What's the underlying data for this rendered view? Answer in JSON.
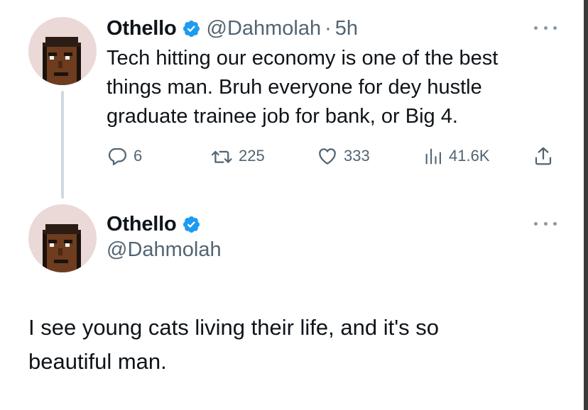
{
  "tweet1": {
    "name": "Othello",
    "handle": "@Dahmolah",
    "separator": "·",
    "time": "5h",
    "text_lines": [
      "Tech hitting our economy is one of the best",
      "things man. Bruh everyone for dey hustle",
      "graduate trainee job for bank, or Big 4."
    ],
    "actions": {
      "replies": "6",
      "reposts": "225",
      "likes": "333",
      "views": "41.6K"
    }
  },
  "tweet2": {
    "name": "Othello",
    "handle": "@Dahmolah",
    "text_lines": [
      "I see young cats living their life, and it's so",
      "beautiful man."
    ]
  },
  "icons": {
    "verified": "verified-badge-icon",
    "more": "more-options-icon",
    "reply": "reply-icon",
    "repost": "repost-icon",
    "like": "heart-icon",
    "views": "views-chart-icon",
    "share": "share-icon"
  },
  "colors": {
    "verified": "#1d9bf0",
    "secondary_text": "#536471",
    "primary_text": "#0f1419",
    "avatar_bg": "#ead9d7",
    "thread_line": "#cfd9de"
  }
}
